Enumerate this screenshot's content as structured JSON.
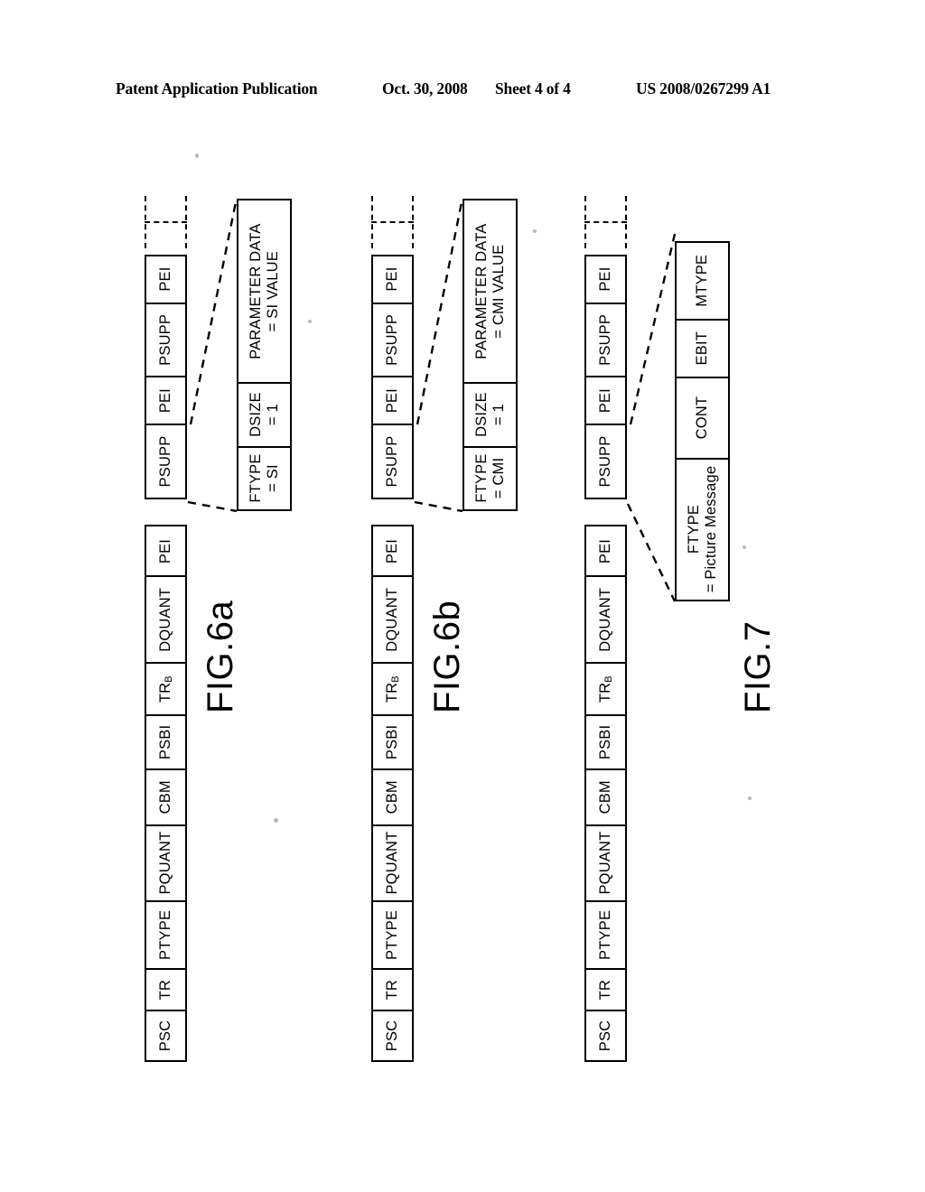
{
  "header": {
    "publication": "Patent Application Publication",
    "date": "Oct. 30, 2008",
    "sheet": "Sheet 4 of 4",
    "number": "US 2008/0267299 A1"
  },
  "figures": [
    {
      "id": "fig-6a",
      "label": "FIG.6a",
      "frame_cells": [
        "PSC",
        "TR",
        "PTYPE",
        "PQUANT",
        "CBM",
        "PSBI",
        "TR",
        "DQUANT",
        "PEI"
      ],
      "frame_cell_subscripts": [
        "",
        "",
        "",
        "",
        "",
        "",
        "B",
        "",
        ""
      ],
      "supplement_cells": [
        "PSUPP",
        "PEI",
        "PSUPP",
        "PEI"
      ],
      "continuation": "dashed-continuation",
      "detail": {
        "cells": [
          {
            "line1": "FTYPE",
            "line2": "= SI"
          },
          {
            "line1": "DSIZE",
            "line2": "= 1"
          },
          {
            "line1": "PARAMETER DATA",
            "line2": "= SI VALUE"
          }
        ]
      }
    },
    {
      "id": "fig-6b",
      "label": "FIG.6b",
      "frame_cells": [
        "PSC",
        "TR",
        "PTYPE",
        "PQUANT",
        "CBM",
        "PSBI",
        "TR",
        "DQUANT",
        "PEI"
      ],
      "frame_cell_subscripts": [
        "",
        "",
        "",
        "",
        "",
        "",
        "B",
        "",
        ""
      ],
      "supplement_cells": [
        "PSUPP",
        "PEI",
        "PSUPP",
        "PEI"
      ],
      "continuation": "dashed-continuation",
      "detail": {
        "cells": [
          {
            "line1": "FTYPE",
            "line2": "= CMI"
          },
          {
            "line1": "DSIZE",
            "line2": "= 1"
          },
          {
            "line1": "PARAMETER DATA",
            "line2": "= CMI VALUE"
          }
        ]
      }
    },
    {
      "id": "fig-7",
      "label": "FIG.7",
      "frame_cells": [
        "PSC",
        "TR",
        "PTYPE",
        "PQUANT",
        "CBM",
        "PSBI",
        "TR",
        "DQUANT",
        "PEI"
      ],
      "frame_cell_subscripts": [
        "",
        "",
        "",
        "",
        "",
        "",
        "B",
        "",
        ""
      ],
      "supplement_cells": [
        "PSUPP",
        "PEI",
        "PSUPP",
        "PEI"
      ],
      "continuation": "dashed-continuation",
      "detail": {
        "cells": [
          {
            "line1": "FTYPE",
            "line2": "= Picture Message"
          },
          {
            "line1": "CONT",
            "line2": ""
          },
          {
            "line1": "EBIT",
            "line2": ""
          },
          {
            "line1": "MTYPE",
            "line2": ""
          }
        ]
      }
    }
  ],
  "colors": {
    "ink": "#000000",
    "paper": "#ffffff"
  }
}
